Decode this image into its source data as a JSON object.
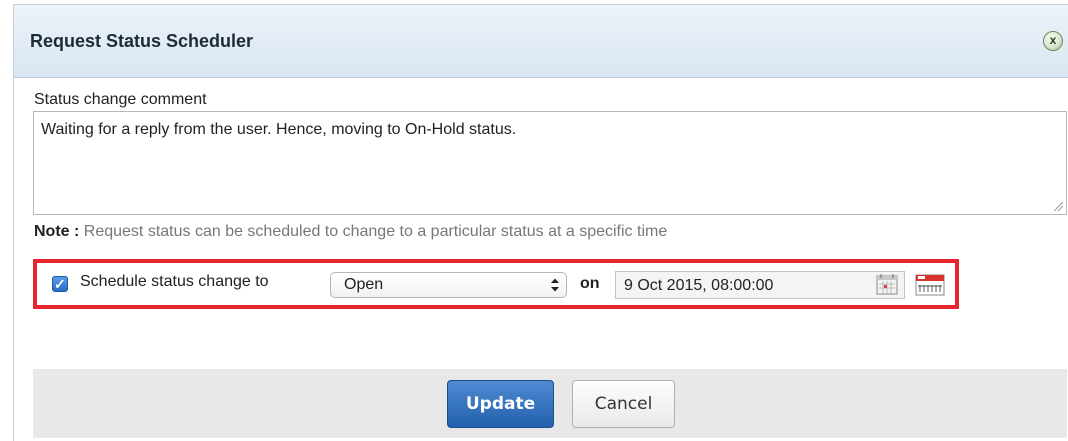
{
  "dialog": {
    "title": "Request Status Scheduler",
    "close_icon": "close-icon"
  },
  "comment": {
    "label": "Status change comment",
    "value": "Waiting for a reply from the user. Hence, moving to On-Hold status."
  },
  "note": {
    "prefix": "Note :",
    "text": " Request status can be scheduled to change to a particular status at a specific time"
  },
  "schedule": {
    "checked": true,
    "label": "Schedule status change to",
    "status_value": "Open",
    "on_label": "on",
    "datetime_value": "9 Oct 2015, 08:00:00",
    "calendar_icon": "calendar-icon",
    "date-picker_icon": "date-picker-icon"
  },
  "buttons": {
    "update": "Update",
    "cancel": "Cancel"
  },
  "colors": {
    "highlight": "#e8272c",
    "primary_button": "#2360ad",
    "titlebar": "#d9e6f2"
  }
}
